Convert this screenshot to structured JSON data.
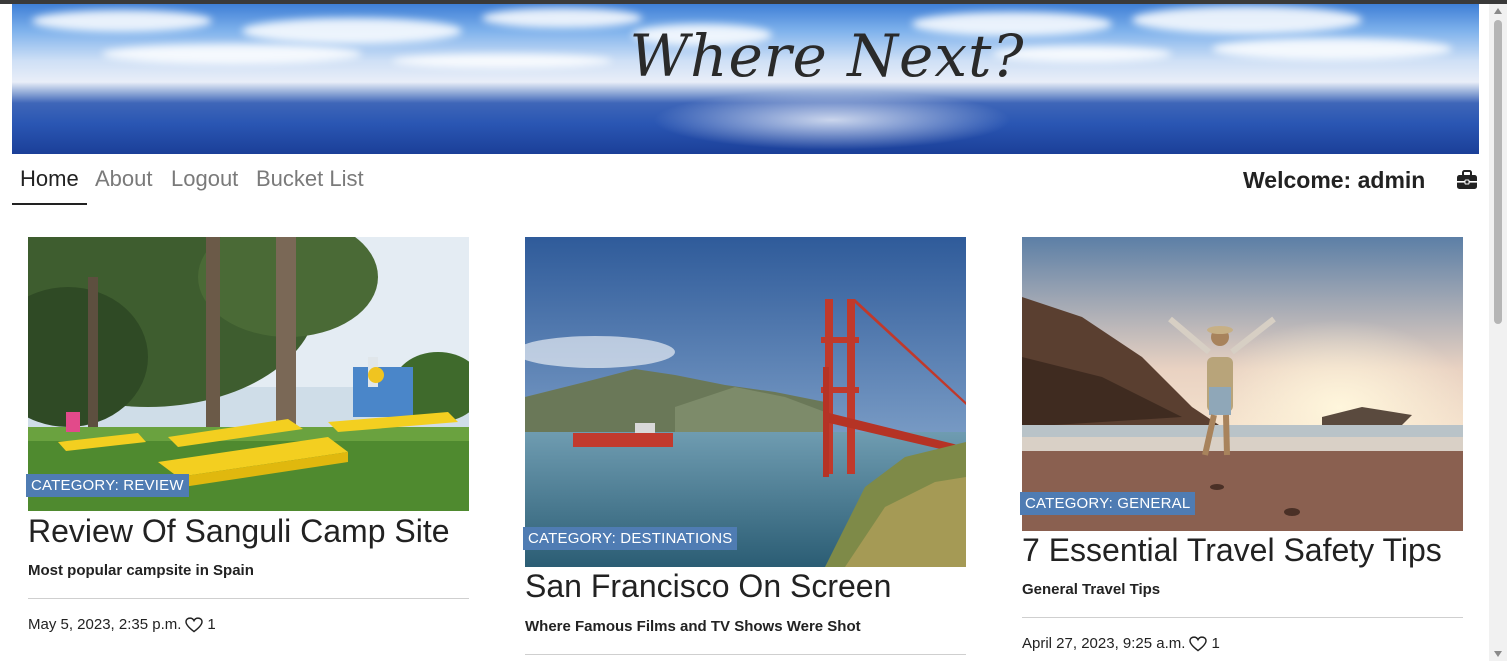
{
  "header": {
    "brand": "Where Next?"
  },
  "nav": {
    "items": [
      {
        "label": "Home"
      },
      {
        "label": "About"
      },
      {
        "label": "Logout"
      },
      {
        "label": "Bucket List"
      }
    ],
    "welcome": "Welcome: admin",
    "briefcase_icon": "briefcase-icon"
  },
  "cards": [
    {
      "category": "CATEGORY: REVIEW",
      "title": "Review Of Sanguli Camp Site",
      "subtitle": "Most popular campsite in Spain",
      "date": "May 5, 2023, 2:35 p.m.",
      "likes": "1",
      "image": "campsite-photo"
    },
    {
      "category": "CATEGORY: DESTINATIONS",
      "title": "San Francisco On Screen",
      "subtitle": "Where Famous Films and TV Shows Were Shot",
      "image": "golden-gate-photo"
    },
    {
      "category": "CATEGORY: GENERAL",
      "title": "7 Essential Travel Safety Tips",
      "subtitle": "General Travel Tips",
      "date": "April 27, 2023, 9:25 a.m.",
      "likes": "1",
      "image": "beach-traveler-photo"
    }
  ],
  "colors": {
    "badge": "#4f7cb3",
    "text": "#222222",
    "nav_muted": "#7a7a7a"
  }
}
